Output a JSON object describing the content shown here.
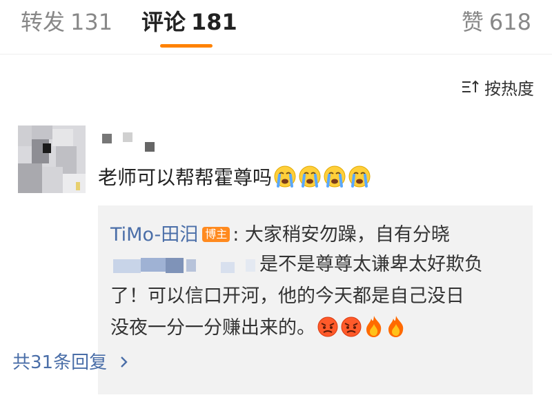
{
  "tabs": {
    "repost": {
      "label": "转发",
      "count": "131"
    },
    "comments": {
      "label": "评论",
      "count": "181"
    },
    "likes": {
      "label": "赞",
      "count": "618"
    }
  },
  "sort": {
    "label": "按热度",
    "icon": "sort-icon"
  },
  "comment": {
    "text": "老师可以帮帮霍尊吗",
    "emoji": "crying-face-emoji",
    "emoji_count": 4
  },
  "reply": {
    "author": "TiMo-田汨",
    "badge": "博主",
    "line1": ": 大家稍安勿躁，自有分晓",
    "line2": "是不是尊尊太谦卑太好欺负",
    "line3": "了！可以信口开河，他的今天都是自己没日",
    "line4": "没夜一分一分赚出来的。",
    "emojis": [
      "angry-face-emoji",
      "angry-face-emoji",
      "fire-emoji",
      "fire-emoji"
    ]
  },
  "more_replies": {
    "label": "共31条回复",
    "icon": "chevron-right-icon"
  },
  "colors": {
    "accent": "#ff8200",
    "link": "#4a6ea8",
    "badge": "#ff8a1f"
  }
}
